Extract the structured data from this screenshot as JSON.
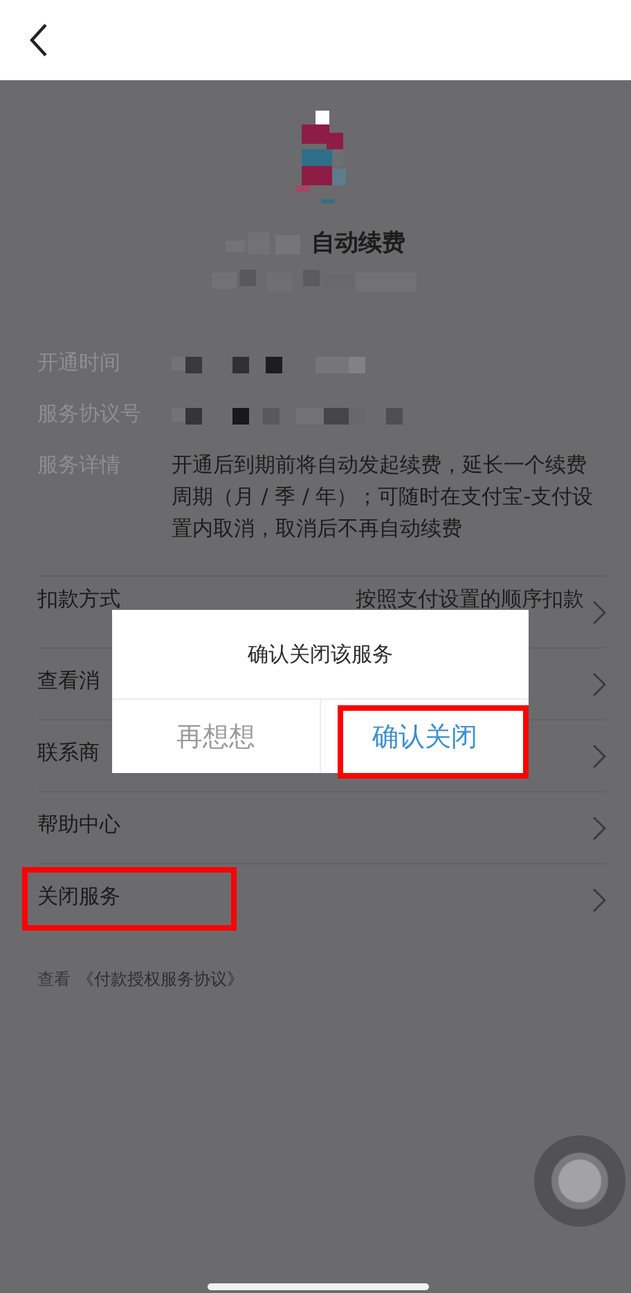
{
  "service": {
    "title": "自动续费"
  },
  "info": [
    {
      "label": "开通时间",
      "kind": "redacted"
    },
    {
      "label": "服务协议号",
      "kind": "redacted"
    },
    {
      "label": "服务详情",
      "kind": "text",
      "value": "开通后到期前将自动发起续费，延长一个续费周期（月 / 季 / 年）；可随时在支付宝-支付设置内取消，取消后不再自动续费"
    }
  ],
  "menu": [
    {
      "label": "扣款方式",
      "value": "按照支付设置的顺序扣款",
      "highlighted": false
    },
    {
      "label": "查看消",
      "highlighted": false
    },
    {
      "label": "联系商",
      "highlighted": false
    },
    {
      "label": "帮助中心",
      "highlighted": false
    },
    {
      "label": "关闭服务",
      "highlighted": true
    }
  ],
  "footer": {
    "prefix": "查看",
    "link": "《付款授权服务协议》"
  },
  "dialog": {
    "title": "确认关闭该服务",
    "buttons": [
      {
        "label": "再想想",
        "kind": "cancel",
        "highlighted": false
      },
      {
        "label": "确认关闭",
        "kind": "confirm",
        "highlighted": true
      }
    ]
  }
}
